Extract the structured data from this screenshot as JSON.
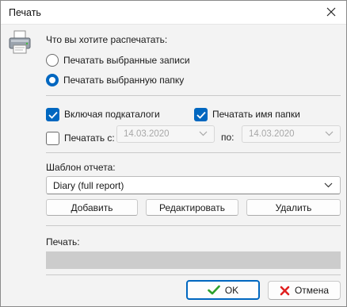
{
  "window": {
    "title": "Печать"
  },
  "icons": {
    "window": "printer-icon",
    "close": "close-icon",
    "ok": "checkmark-icon",
    "cancel": "cross-icon"
  },
  "colors": {
    "accent": "#0067c0",
    "ok_check": "#2ca02c",
    "cancel_cross": "#e02020",
    "progress_track": "#cccccc"
  },
  "selection": {
    "question": "Что вы хотите распечатать:",
    "options": [
      {
        "label": "Печатать выбранные записи",
        "selected": false
      },
      {
        "label": "Печатать выбранную папку",
        "selected": true
      }
    ]
  },
  "options": {
    "include_subfolders": {
      "label": "Включая подкаталоги",
      "checked": true
    },
    "print_folder_name": {
      "label": "Печатать имя папки",
      "checked": true
    },
    "print_from": {
      "label": "Печатать с:",
      "checked": false
    },
    "date_from": "14.03.2020",
    "to_label": "по:",
    "date_to": "14.03.2020"
  },
  "template": {
    "label": "Шаблон отчета:",
    "selected": "Diary (full report)",
    "add_button": "Добавить",
    "edit_button": "Редактировать",
    "delete_button": "Удалить"
  },
  "progress": {
    "label": "Печать:",
    "value": 0
  },
  "footer": {
    "ok": "OK",
    "cancel": "Отмена"
  }
}
